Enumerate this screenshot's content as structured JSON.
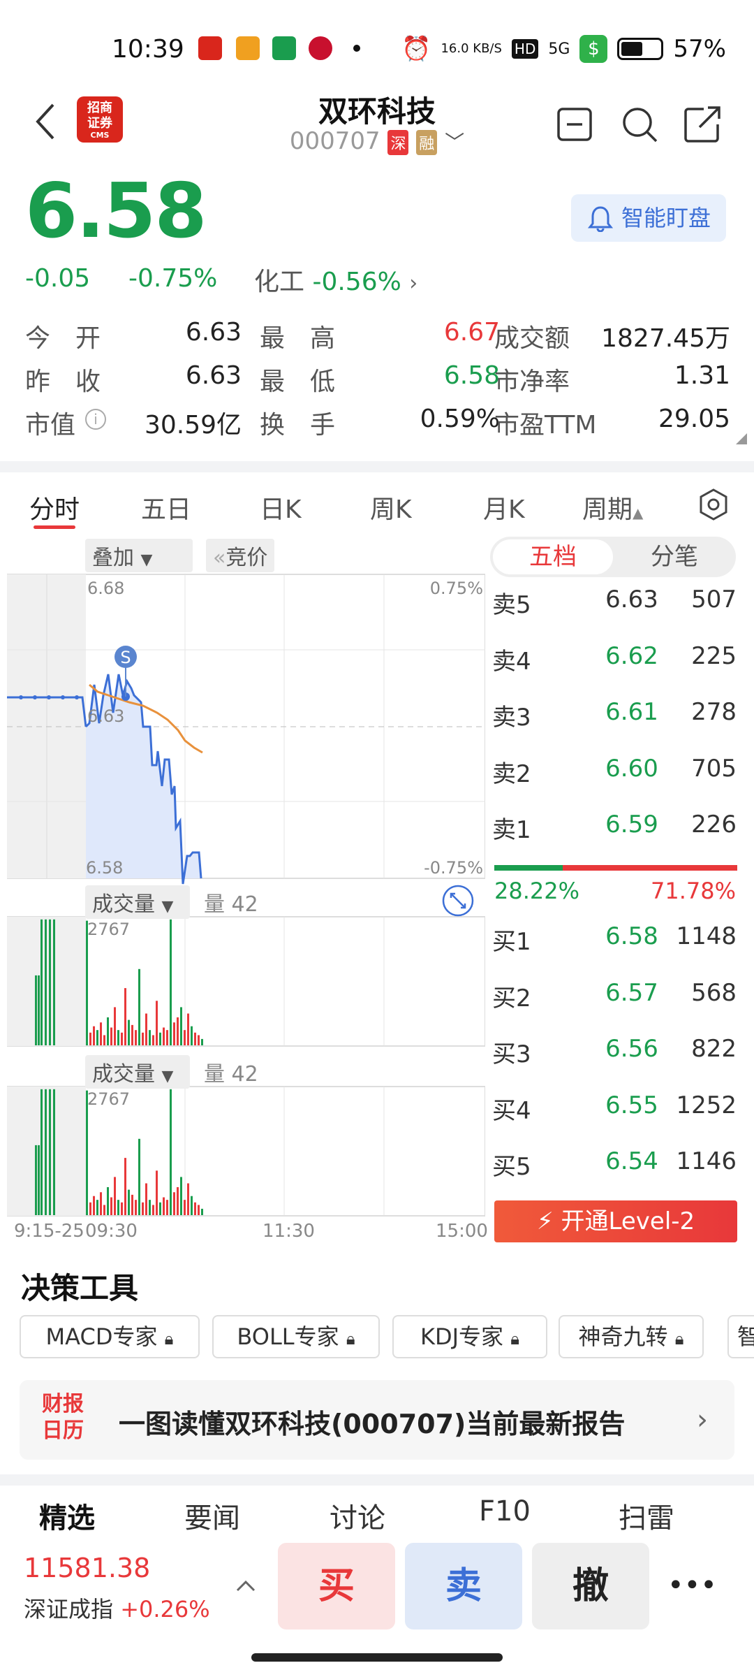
{
  "status_bar": {
    "time": "10:39",
    "net_speed": "16.0 KB/S",
    "hd": "HD",
    "signal": "5G",
    "battery_pct": "57%"
  },
  "header": {
    "logo_text": "招商证券",
    "logo_sub": "CMS",
    "stock_name": "双环科技",
    "stock_code": "000707",
    "tag_market": "深",
    "tag_margin": "融"
  },
  "quote": {
    "price": "6.58",
    "change": "-0.05",
    "change_pct": "-0.75%",
    "sector_name": "化工",
    "sector_change": "-0.56%",
    "smart_watch_label": "智能盯盘"
  },
  "stats": {
    "open_label": "今　开",
    "open": "6.63",
    "high_label": "最　高",
    "high": "6.67",
    "amount_label": "成交额",
    "amount": "1827.45万",
    "prev_close_label": "昨　收",
    "prev_close": "6.63",
    "low_label": "最　低",
    "low": "6.58",
    "pb_label": "市净率",
    "pb": "1.31",
    "mcap_label": "市值",
    "mcap": "30.59亿",
    "turnover_label": "换　手",
    "turnover": "0.59%",
    "pe_label": "市盈TTM",
    "pe": "29.05"
  },
  "tabs": [
    "分时",
    "五日",
    "日K",
    "周K",
    "月K",
    "周期"
  ],
  "chart": {
    "overlay_label": "叠加",
    "auction_label": "竞价",
    "price_top": "6.68",
    "price_mid": "6.63",
    "price_bottom": "6.58",
    "pct_top": "0.75%",
    "pct_bottom": "-0.75%",
    "vol_label": "成交量",
    "vol_value": "量 42",
    "vol_max": "2767",
    "time_labels": [
      "9:15-25",
      "09:30",
      "11:30",
      "15:00"
    ],
    "signal_marker": "S"
  },
  "order_book": {
    "tab_five": "五档",
    "tab_ticks": "分笔",
    "asks": [
      {
        "label": "卖5",
        "price": "6.63",
        "vol": "507"
      },
      {
        "label": "卖4",
        "price": "6.62",
        "vol": "225"
      },
      {
        "label": "卖3",
        "price": "6.61",
        "vol": "278"
      },
      {
        "label": "卖2",
        "price": "6.60",
        "vol": "705"
      },
      {
        "label": "卖1",
        "price": "6.59",
        "vol": "226"
      }
    ],
    "bid_ratio": "28.22%",
    "ask_ratio": "71.78%",
    "bid_ratio_value": 0.2822,
    "bids": [
      {
        "label": "买1",
        "price": "6.58",
        "vol": "1148"
      },
      {
        "label": "买2",
        "price": "6.57",
        "vol": "568"
      },
      {
        "label": "买3",
        "price": "6.56",
        "vol": "822"
      },
      {
        "label": "买4",
        "price": "6.55",
        "vol": "1252"
      },
      {
        "label": "买5",
        "price": "6.54",
        "vol": "1146"
      }
    ],
    "level2_label": "开通Level-2"
  },
  "tools": {
    "title": "决策工具",
    "items": [
      "MACD专家",
      "BOLL专家",
      "KDJ专家",
      "神奇九转",
      "智"
    ]
  },
  "report": {
    "logo_line1": "财报",
    "logo_line2": "日历",
    "text": "一图读懂双环科技(000707)当前最新报告"
  },
  "bottom_tabs": [
    "精选",
    "要闻",
    "讨论",
    "F10",
    "扫雷"
  ],
  "index": {
    "value": "11581.38",
    "name": "深证成指",
    "change": "+0.26%"
  },
  "actions": {
    "buy": "买",
    "sell": "卖",
    "cancel": "撤",
    "more": "•••"
  },
  "colors": {
    "up": "#e8383a",
    "down": "#1a9d4e",
    "accent": "#3c6fd6"
  }
}
